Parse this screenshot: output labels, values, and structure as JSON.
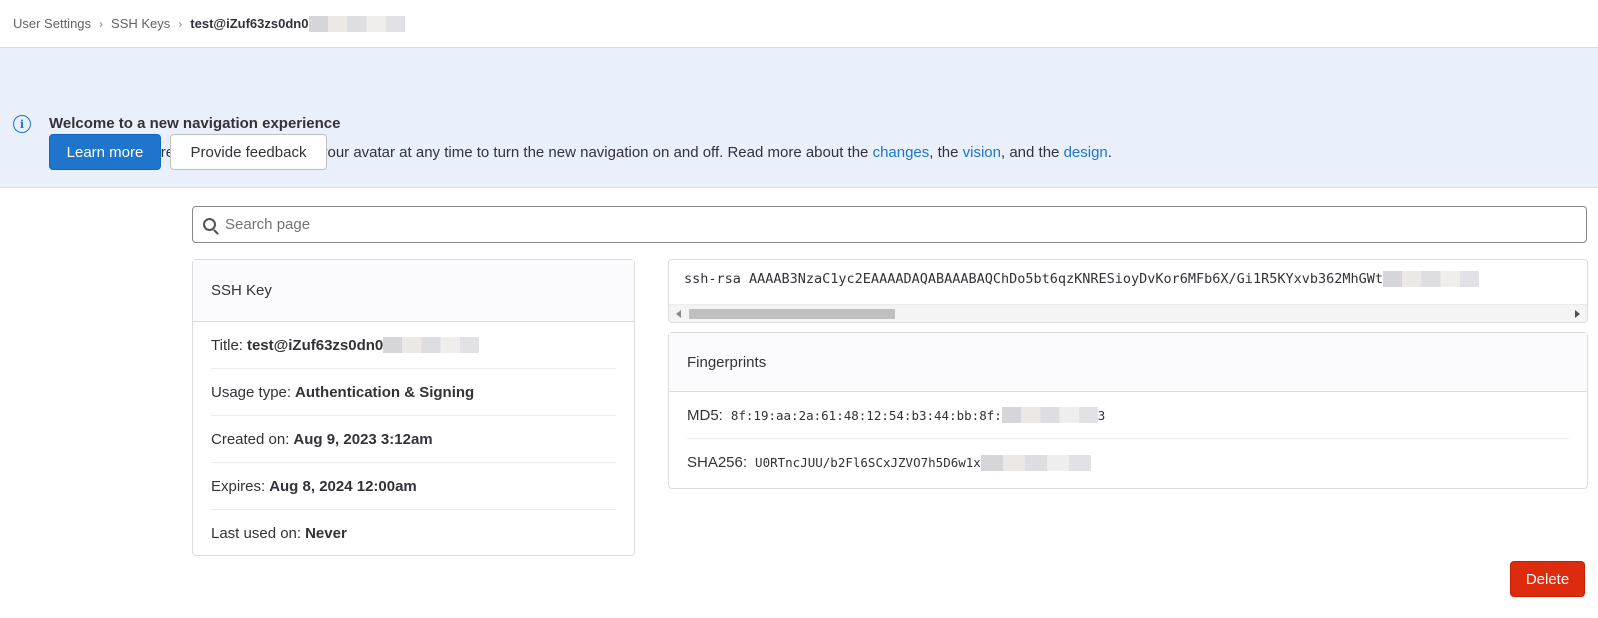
{
  "breadcrumb": {
    "items": [
      "User Settings",
      "SSH Keys"
    ],
    "current": "test@iZuf63zs0dn0"
  },
  "banner": {
    "title": "Welcome to a new navigation experience",
    "text_prefix": "For the next few releases, you can go to your avatar at any time to turn the new navigation on and off. Read more about the ",
    "link_changes": "changes",
    "text_mid1": ", the ",
    "link_vision": "vision",
    "text_mid2": ", and the ",
    "link_design": "design",
    "text_suffix": ".",
    "learn_more": "Learn more",
    "provide_feedback": "Provide feedback",
    "accent_color": "#1f75cb"
  },
  "search": {
    "placeholder": "Search page"
  },
  "ssh_key_card": {
    "header": "SSH Key",
    "rows": [
      {
        "label": "Title:",
        "value": "test@iZuf63zs0dn0"
      },
      {
        "label": "Usage type:",
        "value": "Authentication & Signing"
      },
      {
        "label": "Created on:",
        "value": "Aug 9, 2023 3:12am"
      },
      {
        "label": "Expires:",
        "value": "Aug 8, 2024 12:00am"
      },
      {
        "label": "Last used on:",
        "value": "Never"
      }
    ]
  },
  "key_box": {
    "key_text": "ssh-rsa AAAAB3NzaC1yc2EAAAADAQABAAABAQChDo5bt6qzKNRESioyDvKor6MFb6X/Gi1R5KYxvb362MhGWt"
  },
  "fingerprints": {
    "header": "Fingerprints",
    "md5_label": "MD5:",
    "md5_value": "8f:19:aa:2a:61:48:12:54:b3:44:bb:8f:",
    "md5_tail": "3",
    "sha256_label": "SHA256:",
    "sha256_value": "U0RTncJUU/b2Fl6SCxJZVO7h5D6w1x"
  },
  "actions": {
    "delete": "Delete",
    "danger_color": "#dd2b0e"
  }
}
